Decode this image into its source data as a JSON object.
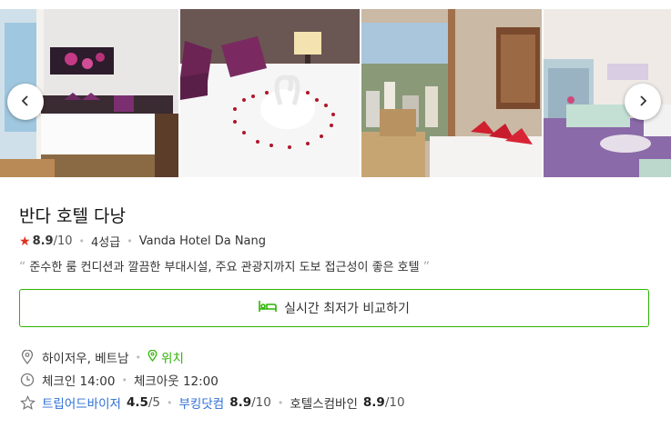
{
  "hotel": {
    "name": "반다 호텔 다낭",
    "rating_score": "8.9",
    "rating_scale": "/10",
    "star_grade": "4성급",
    "english_name": "Vanda Hotel Da Nang",
    "quote_open": "“",
    "quote": "준수한 룸 컨디션과 깔끔한 부대시설, 주요 관광지까지 도보 접근성이 좋은 호텔",
    "quote_close": "”"
  },
  "cta": {
    "label": "실시간 최저가 비교하기"
  },
  "info": {
    "location": "하이저우, 베트남",
    "location_link": "위치",
    "checkin": "체크인 14:00",
    "checkout": "체크아웃 12:00"
  },
  "reviews": [
    {
      "site": "트립어드바이저",
      "score": "4.5",
      "scale": "/5"
    },
    {
      "site": "부킹닷컴",
      "score": "8.9",
      "scale": "/10"
    },
    {
      "site": "호텔스컴바인",
      "score": "8.9",
      "scale": "/10"
    }
  ],
  "icons": {
    "prev": "chevron-left-icon",
    "next": "chevron-right-icon",
    "rating": "star-icon",
    "bed": "bed-icon",
    "location": "location-icon",
    "map_pin": "map-pin-icon",
    "clock": "clock-icon",
    "review": "star-outline-icon"
  },
  "colors": {
    "accent": "#2db400",
    "link": "#2f6fd6",
    "rating_star": "#e0301e"
  }
}
